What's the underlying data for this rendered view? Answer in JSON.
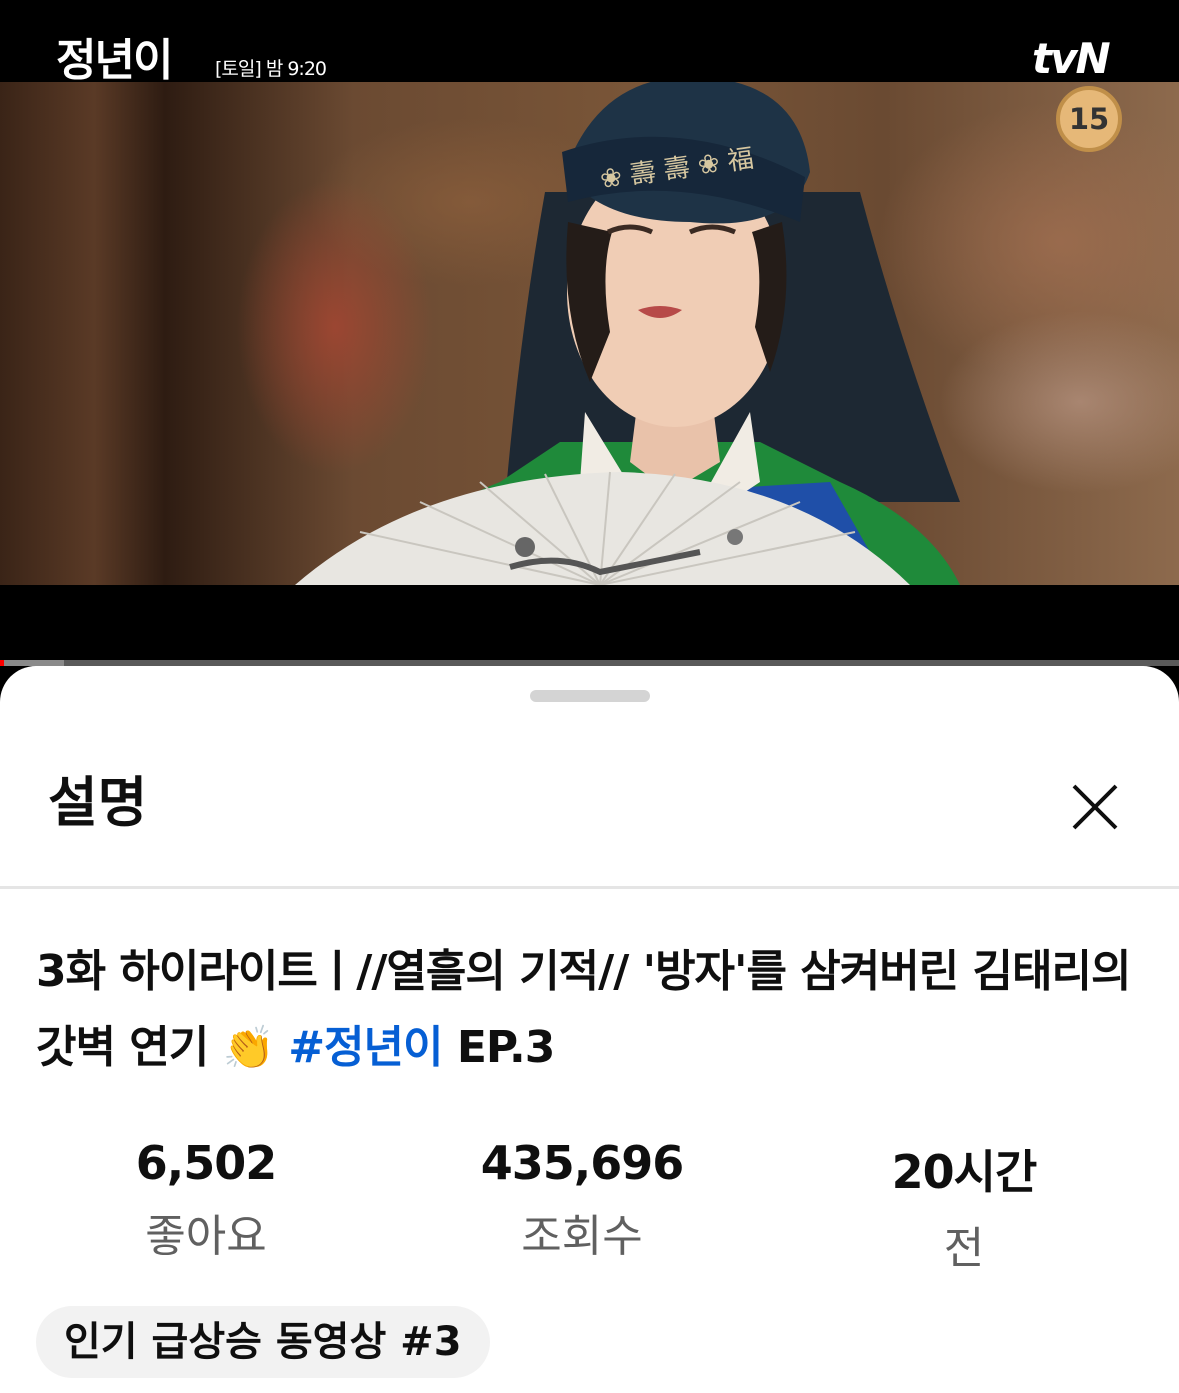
{
  "video": {
    "show_logo": "정년이",
    "air_time": "[토일] 밤 9:20",
    "channel_logo": "tvN",
    "age_rating": "15",
    "progress_fraction": 0.003,
    "buffered_fraction": 0.054
  },
  "sheet": {
    "title": "설명",
    "close_icon": "close-icon"
  },
  "description": {
    "title_text": "3화 하이라이트ㅣ//열흘의 기적// '방자'를 삼켜버린 김태리의 갓벽 연기 ",
    "emoji": "👏",
    "hashtag": "#정년이",
    "suffix": " EP.3",
    "hashtag_color": "#065fd4"
  },
  "stats": {
    "likes_value": "6,502",
    "likes_label": "좋아요",
    "views_value": "435,696",
    "views_label": "조회수",
    "date_value": "20시간",
    "date_label": "전"
  },
  "trending_chip": "인기 급상승 동영상 #3"
}
